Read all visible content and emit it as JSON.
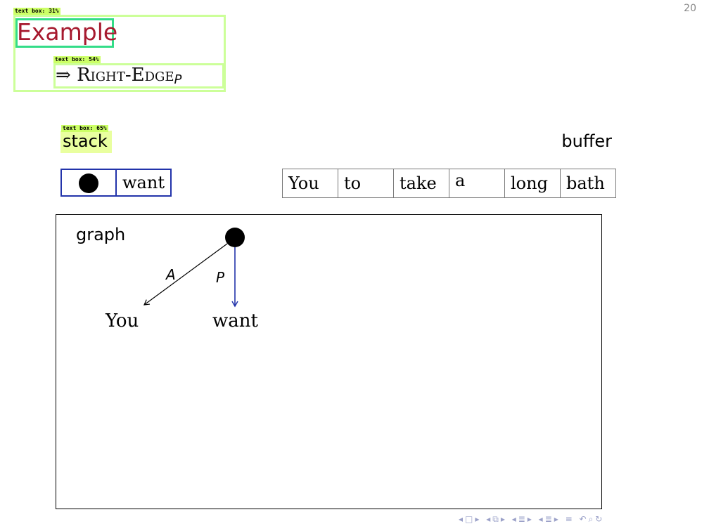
{
  "page_number": "20",
  "annotations": {
    "title_box": "text box: 31%",
    "subtitle_box": "text box: 54%",
    "stack_box": "text box: 65%"
  },
  "title": "Example",
  "subtitle": {
    "arrow": "⇒",
    "text": "Right-Edge",
    "subscript": "P"
  },
  "stack": {
    "label": "stack",
    "cells": [
      "●",
      "want"
    ]
  },
  "buffer": {
    "label": "buffer",
    "cells": [
      "You",
      "to",
      "take",
      "a",
      "long",
      "bath"
    ]
  },
  "graph": {
    "label": "graph",
    "nodes": [
      "You",
      "want"
    ],
    "edges": [
      {
        "from": "root",
        "to": "You",
        "label": "A",
        "color": "#000000"
      },
      {
        "from": "root",
        "to": "want",
        "label": "P",
        "color": "#2233aa"
      }
    ]
  },
  "colors": {
    "title": "#a6192e",
    "stack_border": "#2233aa",
    "annotation": "#ccff66"
  },
  "nav_icons": [
    "left-arrow-icon",
    "frame-icon",
    "right-arrow-icon",
    "section-icon",
    "subsection-icon",
    "zoom-icon",
    "refresh-icon"
  ]
}
